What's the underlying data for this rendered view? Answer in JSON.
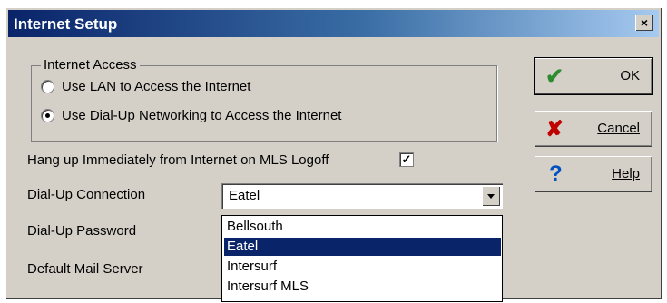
{
  "window": {
    "title": "Internet Setup",
    "close_glyph": "×"
  },
  "internet_access": {
    "group_label": "Internet Access",
    "options": [
      {
        "label": "Use LAN to Access the Internet",
        "checked": false
      },
      {
        "label": "Use Dial-Up Networking to Access the Internet",
        "checked": true
      }
    ]
  },
  "hangup": {
    "label": "Hang up Immediately from Internet on MLS Logoff",
    "checked": true,
    "check_glyph": "✓"
  },
  "fields": {
    "dialup_connection_label": "Dial-Up Connection",
    "dialup_password_label": "Dial-Up Password",
    "default_mail_label": "Default Mail Server",
    "dialup_connection_value": "Eatel"
  },
  "dropdown": {
    "items": [
      "Bellsouth",
      "Eatel",
      "Intersurf",
      "Intersurf MLS"
    ],
    "selected_index": 1
  },
  "buttons": {
    "ok": {
      "label": "OK",
      "icon": "check-icon",
      "glyph": "✔",
      "color": "#2e8b2e"
    },
    "cancel": {
      "label": "Cancel",
      "icon": "cross-icon",
      "glyph": "✘",
      "color": "#c00000"
    },
    "help": {
      "label": "Help",
      "icon": "question-icon",
      "glyph": "?",
      "color": "#0050c0"
    }
  }
}
